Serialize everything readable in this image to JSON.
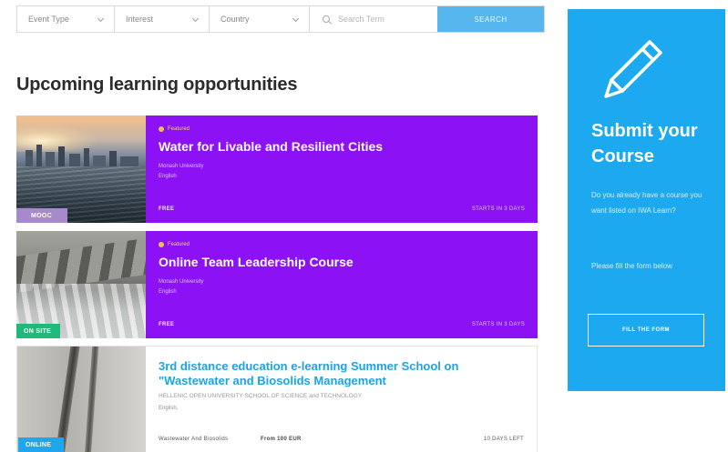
{
  "filters": {
    "event_type": "Event Type",
    "interest": "Interest",
    "country": "Country",
    "search_placeholder": "Search Term",
    "search_button": "SEARCH"
  },
  "page_title": "Upcoming learning opportunities",
  "cards": [
    {
      "badge": "MOOC",
      "featured": "Featured",
      "title": "Water for Livable and Resilient Cities",
      "institution": "Monash University",
      "language": "English",
      "price": "FREE",
      "starts": "STARTS IN 3 DAYS"
    },
    {
      "badge": "ON SITE",
      "featured": "Featured",
      "title": "Online Team Leadership Course",
      "institution": "Monash University",
      "language": "English",
      "price": "FREE",
      "starts": "STARTS IN 3 DAYS"
    },
    {
      "badge": "ONLINE",
      "title": "3rd distance education e-learning Summer School on \"Wastewater and Biosolids Management",
      "institution": "HELLENIC OPEN UNIVERSITY SCHOOL OF SCIENCE and TECHNOLOGY",
      "language": "English,",
      "topic": "Wastewater And Biosolids",
      "price": "From 100 EUR",
      "days_left": "10 DAYS LEFT"
    }
  ],
  "sidebar": {
    "title": "Submit your Course",
    "text1": "Do you already have a course you want listed on IWA Learn?",
    "text2": "Please fill the form below",
    "button": "FILL THE FORM"
  },
  "colors": {
    "accent_blue": "#1da9ef",
    "card_purple": "#8c12f5",
    "search_button": "#56b7ef",
    "badge_onsite": "#21b97a",
    "badge_online": "#20a6ee",
    "badge_mooc": "#a78acb"
  }
}
